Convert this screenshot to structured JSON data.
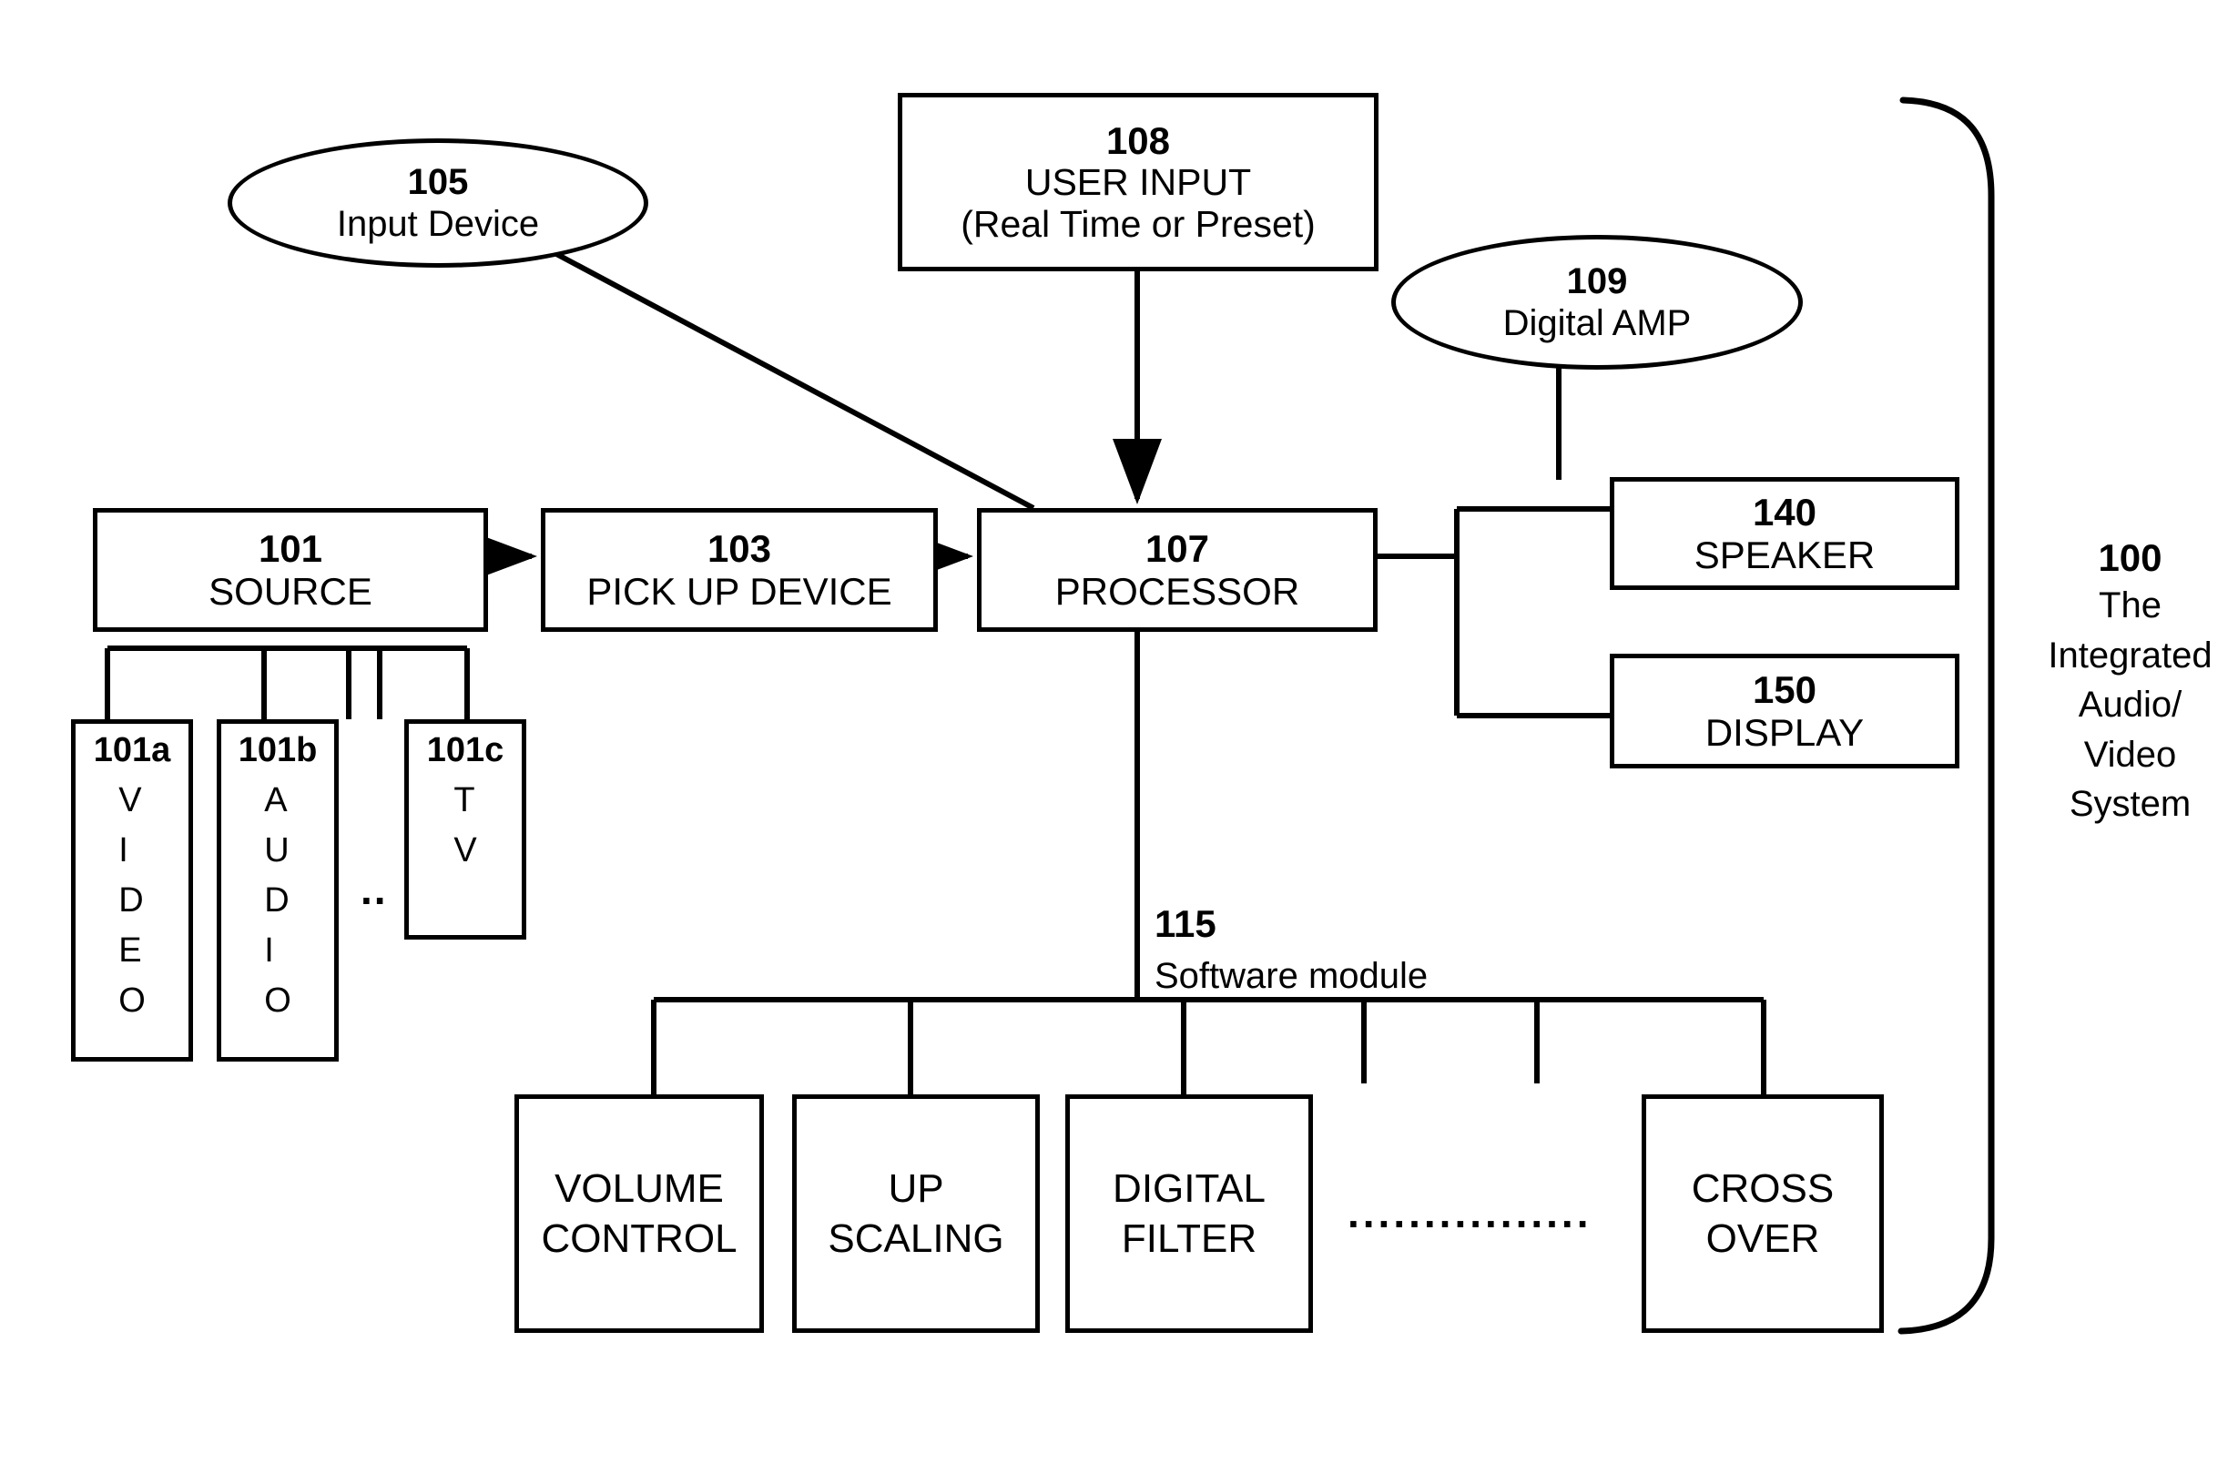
{
  "figure": {
    "system_label": {
      "ref": "100",
      "lines": [
        "The",
        "Integrated",
        "Audio/",
        "Video",
        "System"
      ],
      "text": "100 The Integrated Audio/ Video System"
    },
    "software_module_label": {
      "ref": "115",
      "title": "Software module"
    },
    "ellipsis": "................",
    "source_ellipsis": ".."
  },
  "nodes": {
    "input_device": {
      "ref": "105",
      "title": "Input Device",
      "shape": "ellipse"
    },
    "user_input": {
      "ref": "108",
      "title": "USER INPUT",
      "subtitle": "(Real Time or Preset)",
      "shape": "rect"
    },
    "digital_amp": {
      "ref": "109",
      "title": "Digital AMP",
      "shape": "ellipse"
    },
    "source": {
      "ref": "101",
      "title": "SOURCE",
      "shape": "rect"
    },
    "pickup": {
      "ref": "103",
      "title": "PICK UP DEVICE",
      "shape": "rect"
    },
    "processor": {
      "ref": "107",
      "title": "PROCESSOR",
      "shape": "rect"
    },
    "speaker": {
      "ref": "140",
      "title": "SPEAKER",
      "shape": "rect"
    },
    "display": {
      "ref": "150",
      "title": "DISPLAY",
      "shape": "rect"
    }
  },
  "source_children": [
    {
      "ref": "101a",
      "title": "VIDEO",
      "letters": [
        "V",
        "I",
        "D",
        "E",
        "O"
      ]
    },
    {
      "ref": "101b",
      "title": "AUDIO",
      "letters": [
        "A",
        "U",
        "D",
        "I",
        "O"
      ]
    },
    {
      "ref": "101c",
      "title": "TV",
      "letters": [
        "T",
        "V"
      ]
    }
  ],
  "software_modules": [
    {
      "line1": "VOLUME",
      "line2": "CONTROL"
    },
    {
      "line1": "UP",
      "line2": "SCALING"
    },
    {
      "line1": "DIGITAL",
      "line2": "FILTER"
    },
    {
      "line1": "CROSS",
      "line2": "OVER"
    }
  ],
  "colors": {
    "stroke": "#000000",
    "background": "#ffffff"
  }
}
